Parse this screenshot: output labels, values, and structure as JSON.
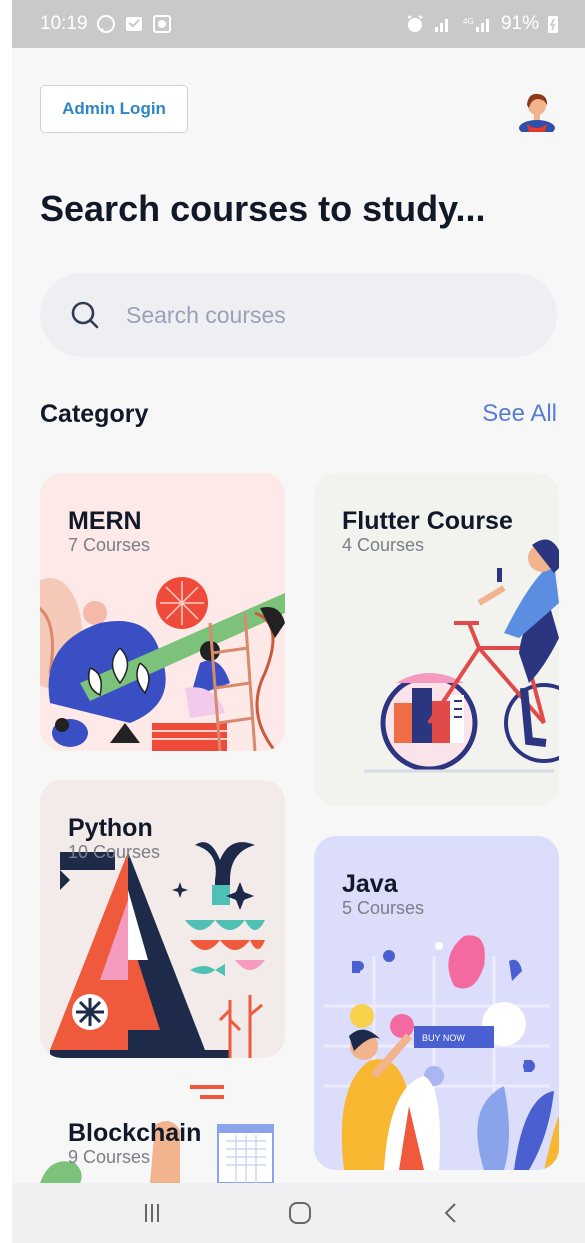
{
  "status_bar": {
    "time": "10:19",
    "battery": "91%"
  },
  "header": {
    "admin_login_label": "Admin Login"
  },
  "headline": "Search courses to study...",
  "search": {
    "placeholder": "Search courses"
  },
  "category": {
    "label": "Category",
    "see_all_label": "See All"
  },
  "courses": [
    {
      "title": "MERN",
      "count": "7 Courses",
      "bg": "#fde9e7"
    },
    {
      "title": "Flutter Course",
      "count": "4 Courses",
      "bg": "#f2f2ef"
    },
    {
      "title": "Python",
      "count": "10 Courses",
      "bg": "#f3ebe9"
    },
    {
      "title": "Java",
      "count": "5 Courses",
      "bg": "#dcdcfb"
    },
    {
      "title": "Blockchain",
      "count": "9 Courses",
      "bg": "#f7f7f8"
    }
  ],
  "colors": {
    "accent": "#2e86c9",
    "see_all": "#5a7bd6",
    "heading": "#111827"
  },
  "icons": {
    "search": "search-icon",
    "recents": "recents-icon",
    "home": "home-icon",
    "back": "back-icon"
  }
}
